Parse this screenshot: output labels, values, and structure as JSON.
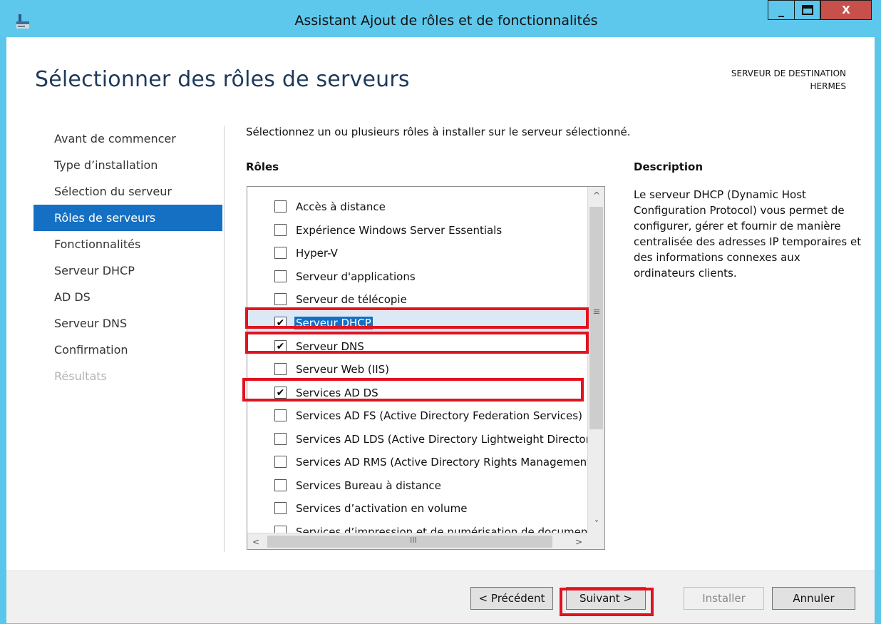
{
  "window": {
    "title": "Assistant Ajout de rôles et de fonctionnalités",
    "minimize": "_",
    "maximize": "□",
    "close": "X"
  },
  "page": {
    "title": "Sélectionner des rôles de serveurs",
    "destination_label": "SERVEUR DE DESTINATION",
    "destination_server": "HERMES"
  },
  "nav": {
    "items": [
      {
        "label": "Avant de commencer",
        "state": "normal"
      },
      {
        "label": "Type d’installation",
        "state": "normal"
      },
      {
        "label": "Sélection du serveur",
        "state": "normal"
      },
      {
        "label": "Rôles de serveurs",
        "state": "active"
      },
      {
        "label": "Fonctionnalités",
        "state": "normal"
      },
      {
        "label": "Serveur DHCP",
        "state": "normal"
      },
      {
        "label": "AD DS",
        "state": "normal"
      },
      {
        "label": "Serveur DNS",
        "state": "normal"
      },
      {
        "label": "Confirmation",
        "state": "normal"
      },
      {
        "label": "Résultats",
        "state": "disabled"
      }
    ]
  },
  "main": {
    "instructions": "Sélectionnez un ou plusieurs rôles à installer sur le serveur sélectionné.",
    "roles_header": "Rôles",
    "description_header": "Description",
    "description_text": "Le serveur DHCP (Dynamic Host Configuration Protocol) vous permet de configurer, gérer et fournir de manière centralisée des adresses IP temporaires et des informations connexes aux ordinateurs clients.",
    "roles": [
      {
        "label": "Accès à distance",
        "checked": false
      },
      {
        "label": "Expérience Windows Server Essentials",
        "checked": false
      },
      {
        "label": "Hyper-V",
        "checked": false
      },
      {
        "label": "Serveur d'applications",
        "checked": false
      },
      {
        "label": "Serveur de télécopie",
        "checked": false
      },
      {
        "label": "Serveur DHCP",
        "checked": true,
        "selected": true
      },
      {
        "label": "Serveur DNS",
        "checked": true
      },
      {
        "label": "Serveur Web (IIS)",
        "checked": false
      },
      {
        "label": "Services AD DS",
        "checked": true
      },
      {
        "label": "Services AD FS (Active Directory Federation Services)",
        "checked": false
      },
      {
        "label": "Services AD LDS (Active Directory Lightweight Directory Services)",
        "checked": false
      },
      {
        "label": "Services AD RMS (Active Directory Rights Management Services)",
        "checked": false
      },
      {
        "label": "Services Bureau à distance",
        "checked": false
      },
      {
        "label": "Services d’activation en volume",
        "checked": false
      },
      {
        "label": "Services d’impression et de numérisation de document",
        "checked": false
      }
    ],
    "check_glyph": "✔"
  },
  "scrollbar": {
    "up": "^",
    "down": "˅",
    "left": "<",
    "right": ">",
    "grip_v": "≡",
    "grip_h": "III"
  },
  "footer": {
    "prev_label": "< Précédent",
    "next_label": "Suivant >",
    "install_label": "Installer",
    "cancel_label": "Annuler"
  },
  "colors": {
    "titlebar": "#5dc8ec",
    "accent": "#1570c4",
    "highlight_box": "#e0131f"
  }
}
